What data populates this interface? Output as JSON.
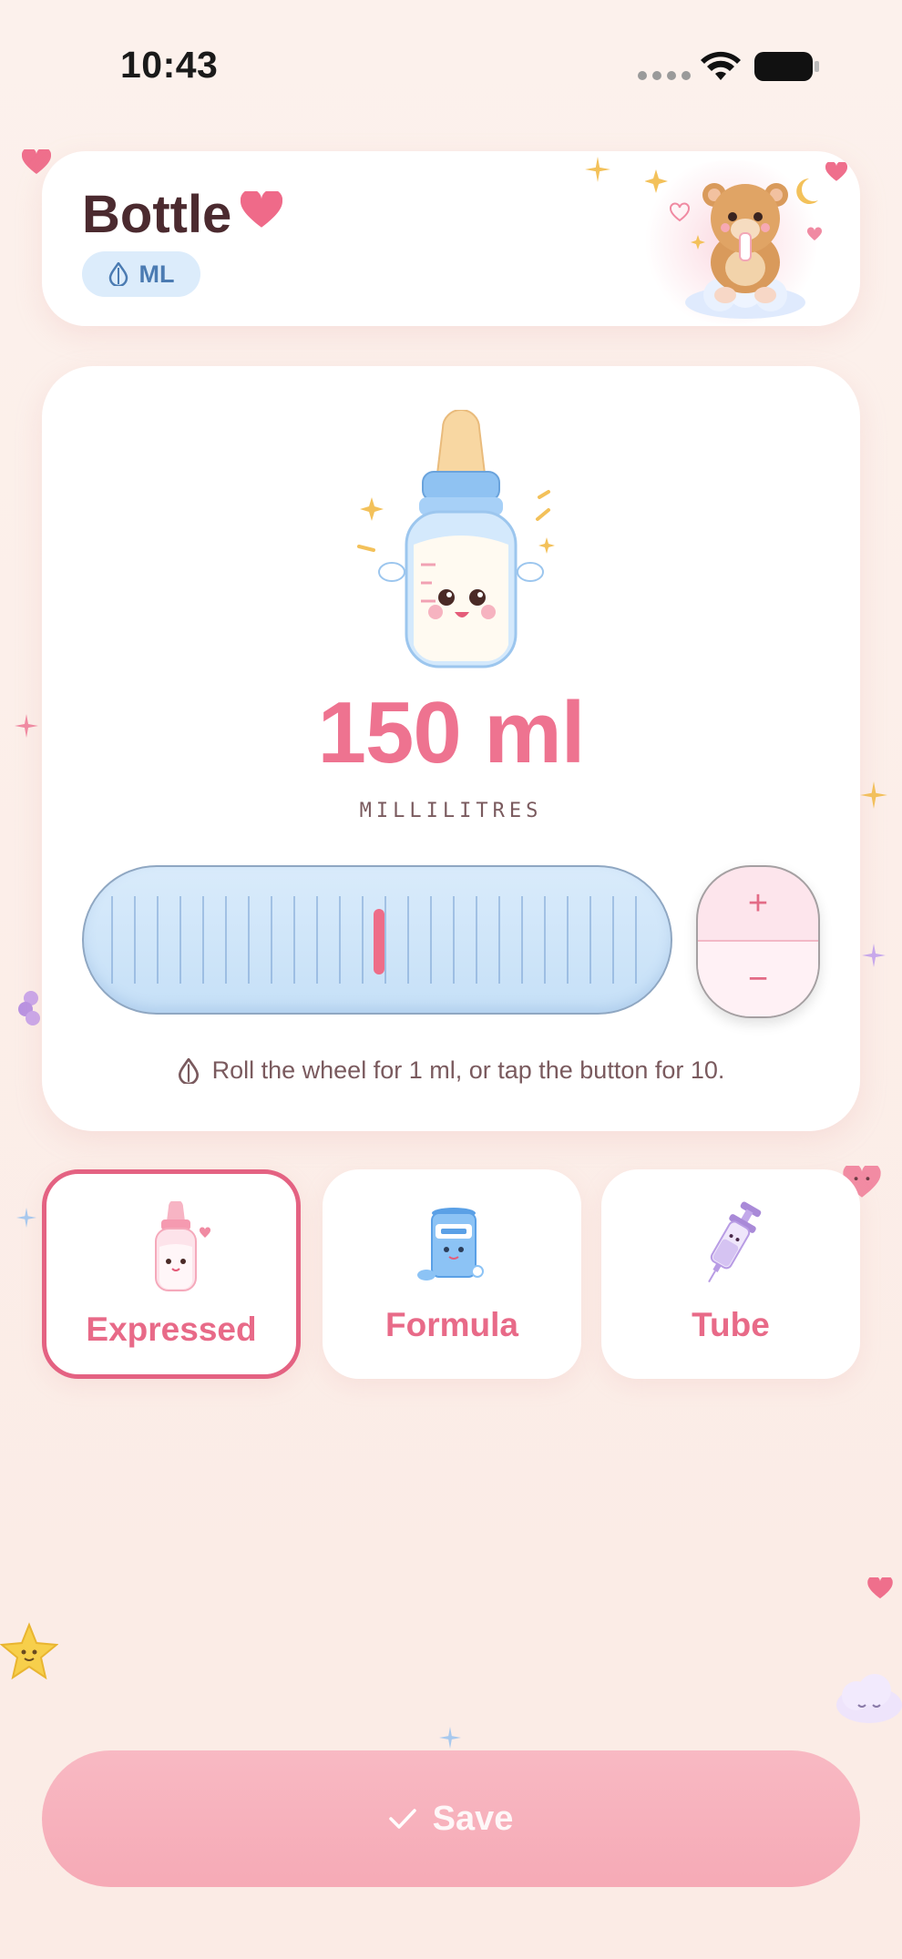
{
  "status_bar": {
    "time": "10:43"
  },
  "header": {
    "title": "Bottle",
    "unit_badge": "ML",
    "title_icon": "heart-icon",
    "illustration": "teddy-bear-with-bottle"
  },
  "amount": {
    "value_text": "150 ml",
    "value": 150,
    "unit_label": "MILLILITRES"
  },
  "stepper": {
    "plus": "+",
    "minus": "−"
  },
  "hint": "Roll the wheel for 1 ml, or tap the button for 10.",
  "types": [
    {
      "label": "Expressed",
      "icon": "expressed-milk-bottle-icon",
      "selected": true
    },
    {
      "label": "Formula",
      "icon": "formula-can-icon",
      "selected": false
    },
    {
      "label": "Tube",
      "icon": "syringe-icon",
      "selected": false
    }
  ],
  "save": {
    "label": "Save",
    "icon": "check-icon"
  },
  "colors": {
    "accent_pink": "#ee7390",
    "badge_blue": "#dcecfb",
    "wheel_blue": "#c6e0f7",
    "save_pink": "#f6aab6"
  }
}
